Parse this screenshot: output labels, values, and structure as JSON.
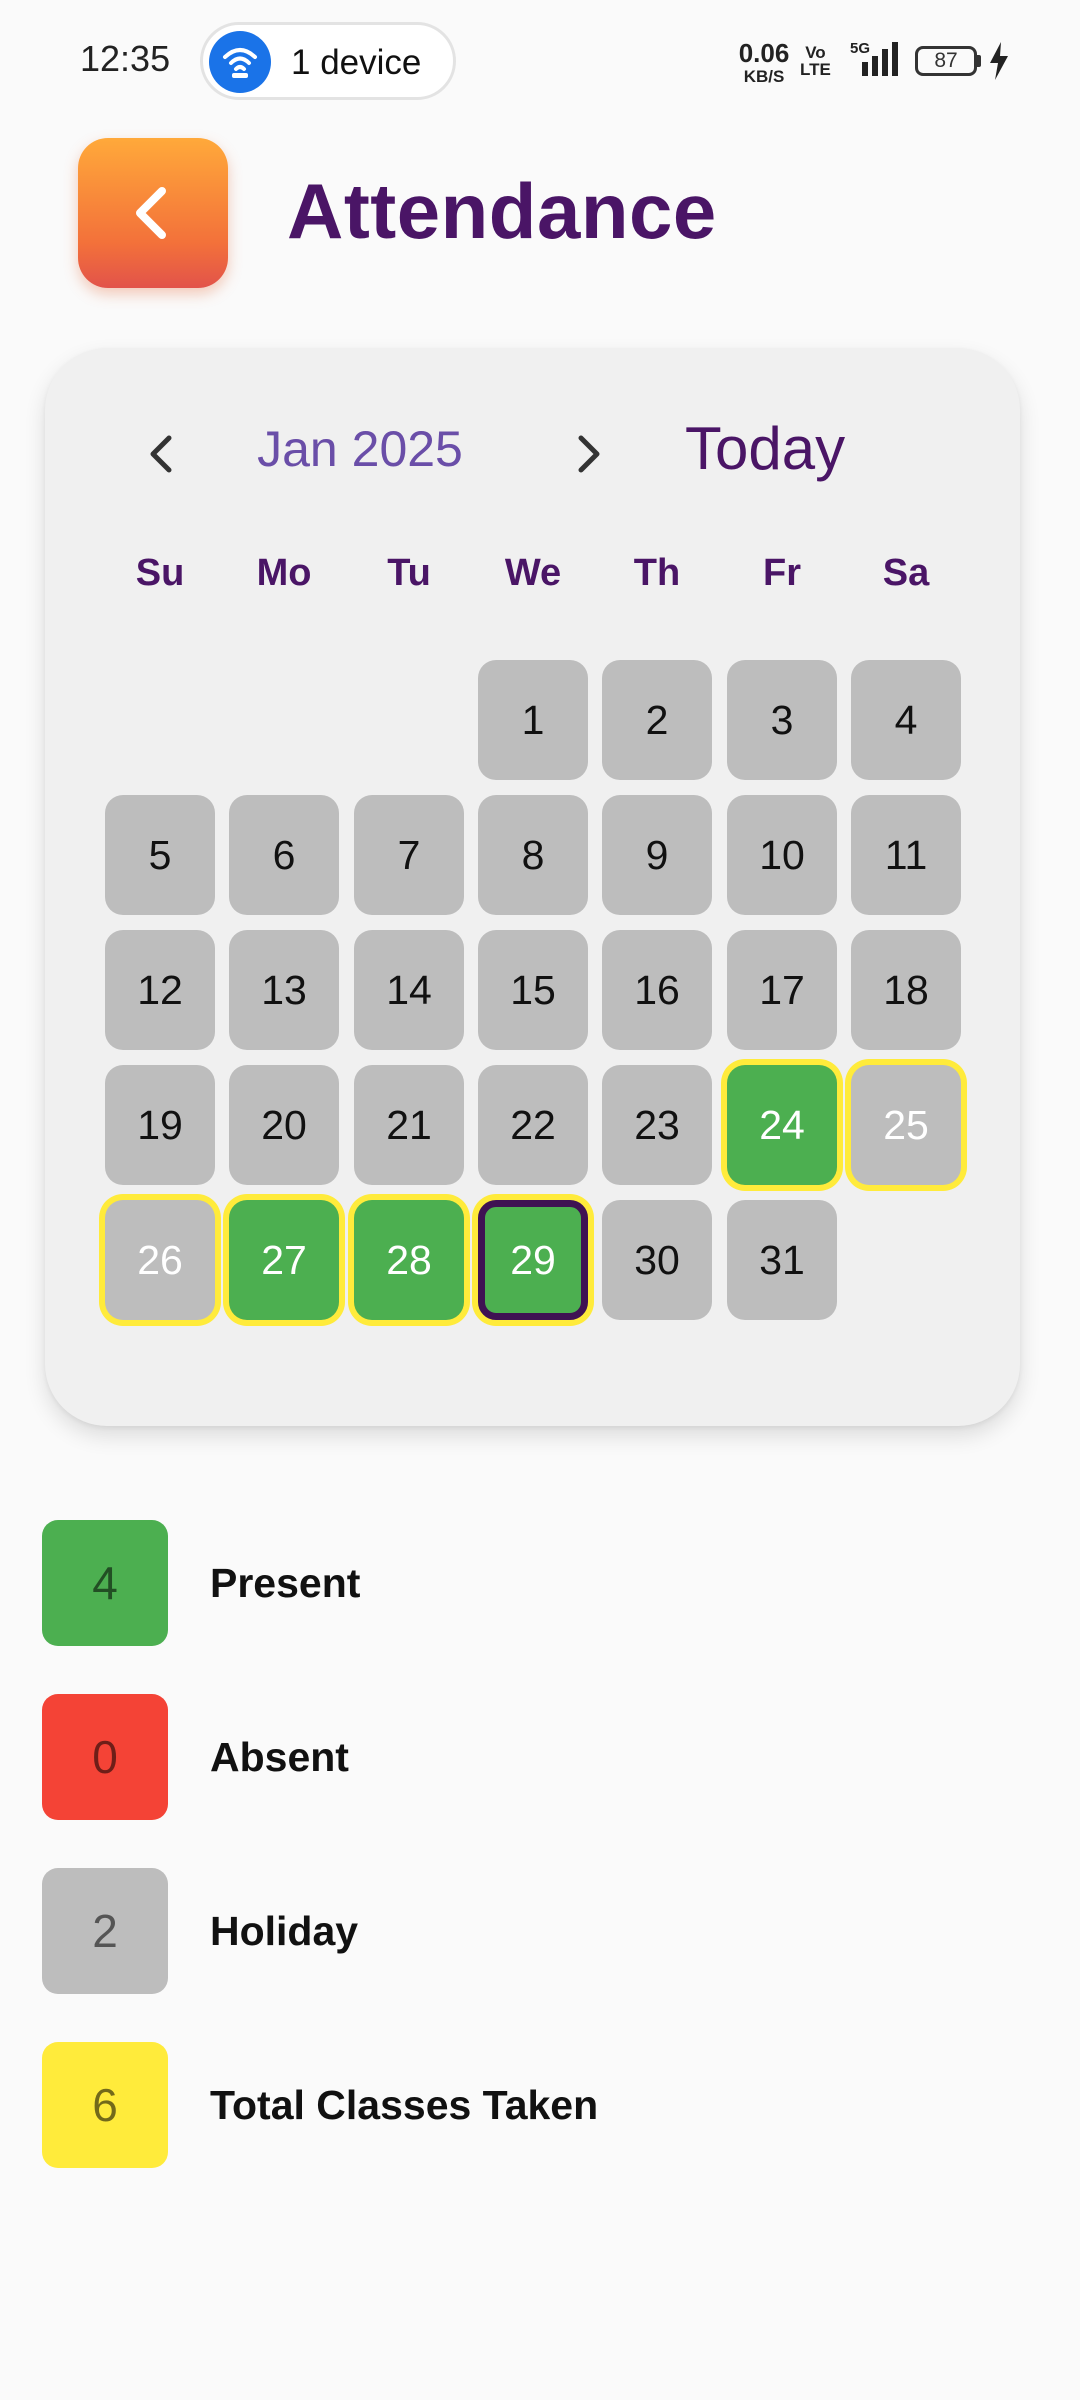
{
  "status_bar": {
    "time": "12:35",
    "device_pill": "1 device",
    "net_speed_value": "0.06",
    "net_speed_unit": "KB/S",
    "volte_top": "Vo",
    "volte_bottom": "LTE",
    "network": "5G",
    "battery": "87"
  },
  "header": {
    "title": "Attendance",
    "back_icon": "chevron-left-icon"
  },
  "calendar": {
    "month_label": "Jan 2025",
    "today_label": "Today",
    "prev_icon": "chevron-left-icon",
    "next_icon": "chevron-right-icon",
    "weekdays": [
      "Su",
      "Mo",
      "Tu",
      "We",
      "Th",
      "Fr",
      "Sa"
    ],
    "first_weekday_index": 3,
    "days": [
      {
        "day": "1",
        "status": "default",
        "ring": false
      },
      {
        "day": "2",
        "status": "default",
        "ring": false
      },
      {
        "day": "3",
        "status": "default",
        "ring": false
      },
      {
        "day": "4",
        "status": "default",
        "ring": false
      },
      {
        "day": "5",
        "status": "default",
        "ring": false
      },
      {
        "day": "6",
        "status": "default",
        "ring": false
      },
      {
        "day": "7",
        "status": "default",
        "ring": false
      },
      {
        "day": "8",
        "status": "default",
        "ring": false
      },
      {
        "day": "9",
        "status": "default",
        "ring": false
      },
      {
        "day": "10",
        "status": "default",
        "ring": false
      },
      {
        "day": "11",
        "status": "default",
        "ring": false
      },
      {
        "day": "12",
        "status": "default",
        "ring": false
      },
      {
        "day": "13",
        "status": "default",
        "ring": false
      },
      {
        "day": "14",
        "status": "default",
        "ring": false
      },
      {
        "day": "15",
        "status": "default",
        "ring": false
      },
      {
        "day": "16",
        "status": "default",
        "ring": false
      },
      {
        "day": "17",
        "status": "default",
        "ring": false
      },
      {
        "day": "18",
        "status": "default",
        "ring": false
      },
      {
        "day": "19",
        "status": "default",
        "ring": false
      },
      {
        "day": "20",
        "status": "default",
        "ring": false
      },
      {
        "day": "21",
        "status": "default",
        "ring": false
      },
      {
        "day": "22",
        "status": "default",
        "ring": false
      },
      {
        "day": "23",
        "status": "default",
        "ring": false
      },
      {
        "day": "24",
        "status": "present",
        "ring": true
      },
      {
        "day": "25",
        "status": "holiday",
        "ring": true
      },
      {
        "day": "26",
        "status": "holiday",
        "ring": true
      },
      {
        "day": "27",
        "status": "present",
        "ring": true
      },
      {
        "day": "28",
        "status": "present",
        "ring": true
      },
      {
        "day": "29",
        "status": "present",
        "ring": true,
        "today": true
      },
      {
        "day": "30",
        "status": "default",
        "ring": false
      },
      {
        "day": "31",
        "status": "default",
        "ring": false
      }
    ]
  },
  "legend": [
    {
      "count": "4",
      "label": "Present",
      "color": "#4caf50"
    },
    {
      "count": "0",
      "label": "Absent",
      "color": "#f44336"
    },
    {
      "count": "2",
      "label": "Holiday",
      "color": "#bdbdbd"
    },
    {
      "count": "6",
      "label": "Total Classes Taken",
      "color": "#ffeb3b"
    }
  ],
  "colors": {
    "primary_purple": "#4a1566",
    "month_purple": "#6a4ea8",
    "present_green": "#4caf50",
    "absent_red": "#f44336",
    "holiday_gray": "#bdbdbd",
    "class_ring_yellow": "#ffeb3b"
  }
}
